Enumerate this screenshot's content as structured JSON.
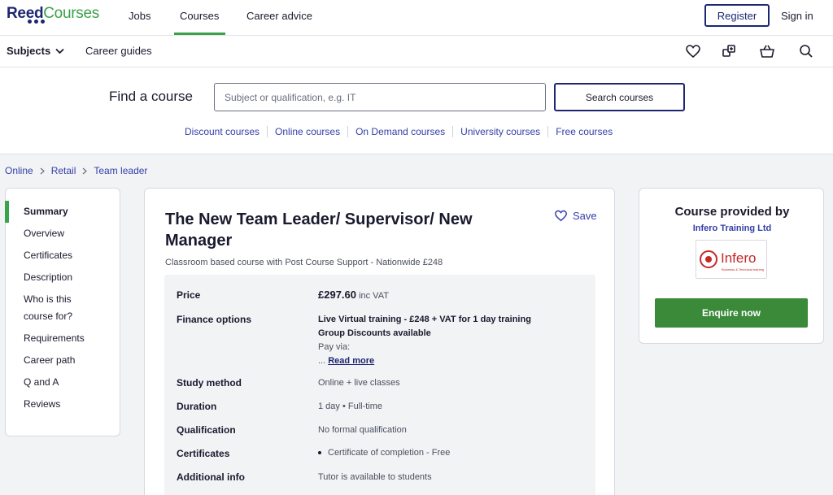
{
  "logo": {
    "reed": "Reed",
    "courses": "Courses"
  },
  "topnav": {
    "jobs": "Jobs",
    "courses": "Courses",
    "career_advice": "Career advice",
    "register": "Register",
    "sign_in": "Sign in"
  },
  "subnav": {
    "subjects": "Subjects",
    "career_guides": "Career guides",
    "icons": [
      "heart-icon",
      "compare-icon",
      "basket-icon",
      "search-icon"
    ]
  },
  "search": {
    "label": "Find a course",
    "placeholder": "Subject or qualification, e.g. IT",
    "button": "Search courses",
    "quicklinks": [
      "Discount courses",
      "Online courses",
      "On Demand courses",
      "University courses",
      "Free courses"
    ]
  },
  "breadcrumb": [
    "Online",
    "Retail",
    "Team leader"
  ],
  "sidenav": {
    "items": [
      "Summary",
      "Overview",
      "Certificates",
      "Description",
      "Who is this course for?",
      "Requirements",
      "Career path",
      "Q and A",
      "Reviews"
    ]
  },
  "course": {
    "title": "The New Team Leader/ Supervisor/ New Manager",
    "save": "Save",
    "subtitle": "Classroom based course with Post Course Support - Nationwide £248",
    "price_label": "Price",
    "price": "£297.60",
    "price_vat": "inc VAT",
    "finance_label": "Finance options",
    "finance_line1": "Live Virtual training - £248 + VAT for 1 day training",
    "finance_line2": "Group Discounts available",
    "finance_line3": "Pay via:",
    "finance_ellipsis": "...",
    "read_more": "Read more",
    "study_label": "Study method",
    "study": "Online + live classes",
    "duration_label": "Duration",
    "duration": "1 day • Full-time",
    "qualification_label": "Qualification",
    "qualification": "No formal qualification",
    "certificates_label": "Certificates",
    "certificate": "Certificate of completion - Free",
    "additional_label": "Additional info",
    "additional": "Tutor is available to students"
  },
  "provider": {
    "title": "Course provided by",
    "name": "Infero Training Ltd",
    "logo_text": "Infero",
    "logo_tagline": "Business & Technical training",
    "enquire": "Enquire now"
  },
  "colors": {
    "brand_navy": "#1d2671",
    "brand_green": "#3aa24a",
    "link_blue": "#343ea8",
    "enquire_green": "#3a8a3a",
    "infero_red": "#c62828"
  }
}
